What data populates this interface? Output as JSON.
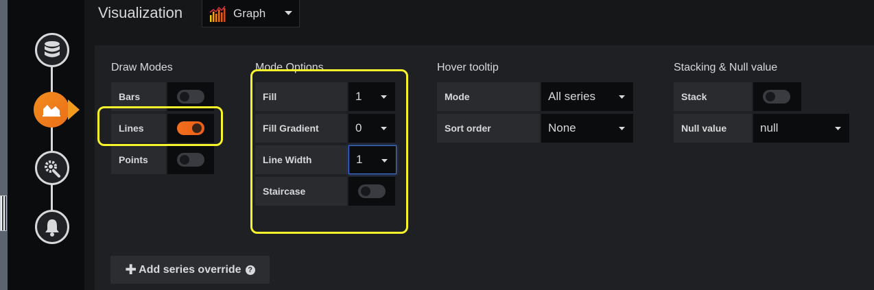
{
  "header": {
    "title": "Visualization",
    "picker": {
      "value": "Graph",
      "icon": "graph-bar-icon"
    }
  },
  "sidenav": {
    "steps": [
      {
        "name": "queries",
        "icon": "database-icon",
        "active": false
      },
      {
        "name": "visualization",
        "icon": "area-chart-icon",
        "active": true
      },
      {
        "name": "general",
        "icon": "gear-wrench-icon",
        "active": false
      },
      {
        "name": "alert",
        "icon": "bell-icon",
        "active": false
      }
    ]
  },
  "draw_modes": {
    "title": "Draw Modes",
    "bars": {
      "label": "Bars",
      "on": false
    },
    "lines": {
      "label": "Lines",
      "on": true
    },
    "points": {
      "label": "Points",
      "on": false
    }
  },
  "mode_options": {
    "title": "Mode Options",
    "fill": {
      "label": "Fill",
      "value": "1"
    },
    "fill_gradient": {
      "label": "Fill Gradient",
      "value": "0"
    },
    "line_width": {
      "label": "Line Width",
      "value": "1"
    },
    "staircase": {
      "label": "Staircase",
      "on": false
    }
  },
  "hover_tooltip": {
    "title": "Hover tooltip",
    "mode": {
      "label": "Mode",
      "value": "All series"
    },
    "sort_order": {
      "label": "Sort order",
      "value": "None"
    }
  },
  "stacking": {
    "title": "Stacking & Null value",
    "stack": {
      "label": "Stack",
      "on": false
    },
    "null_value": {
      "label": "Null value",
      "value": "null"
    }
  },
  "add_override": {
    "label": "Add series override",
    "icon": "plus-icon",
    "help_icon": "question-circle-icon"
  },
  "colors": {
    "accent": "#eb6f1a",
    "highlight": "#f8f42c",
    "focus": "#3d71d9"
  }
}
